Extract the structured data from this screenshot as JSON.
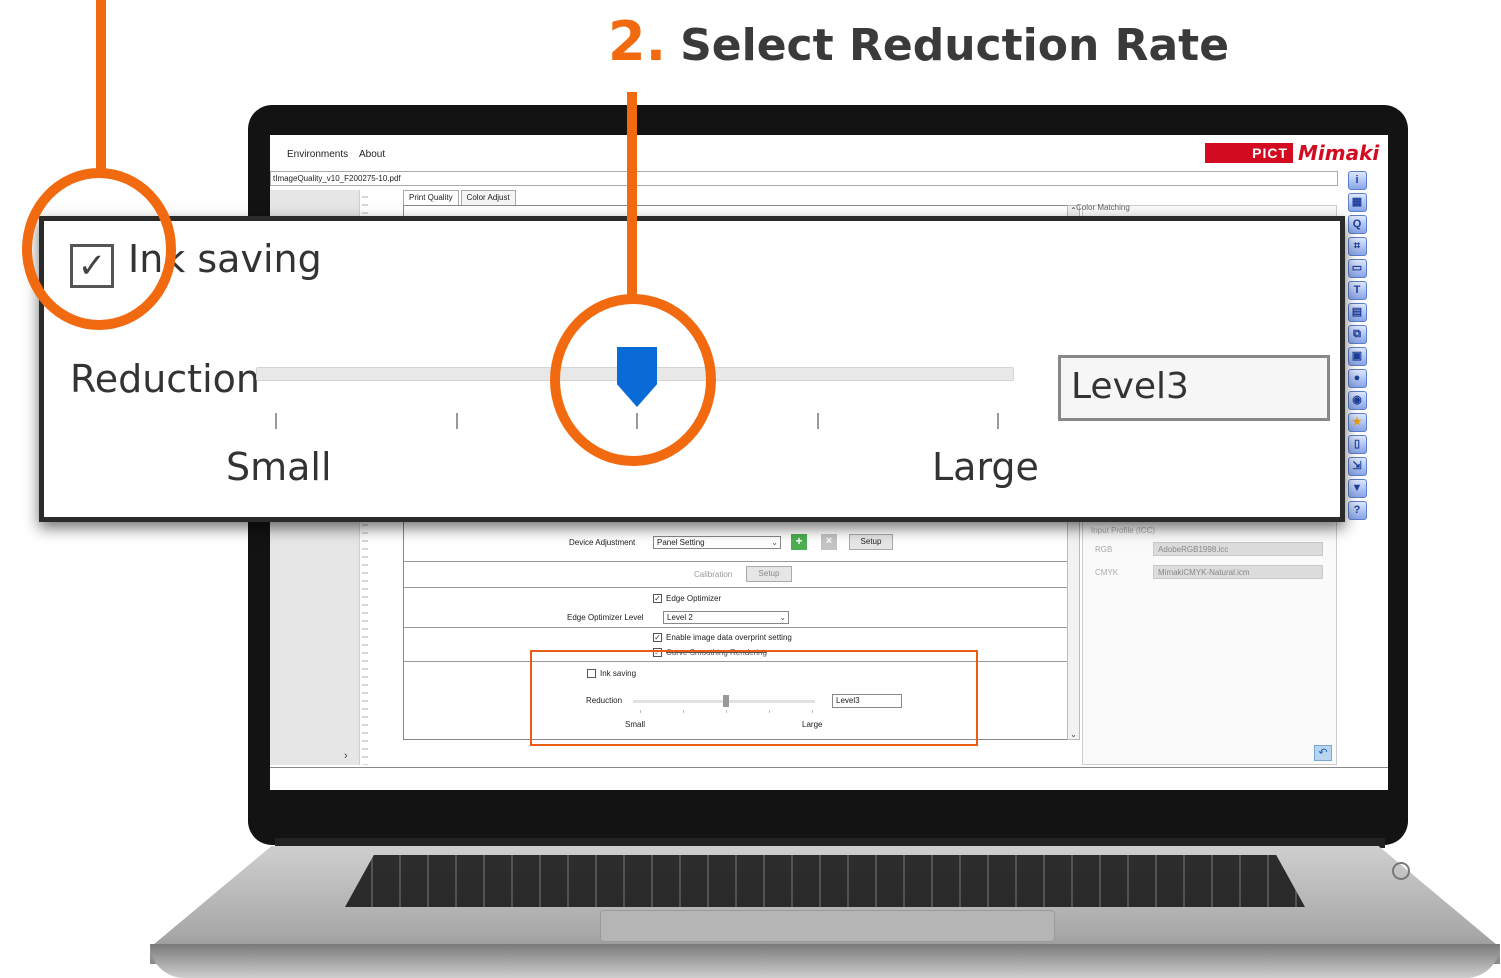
{
  "annotation": {
    "step_number": "2.",
    "step_title": "Select Reduction Rate",
    "accent_color": "#f26a10"
  },
  "app": {
    "menu": [
      "Environments",
      "About"
    ],
    "brand_pict": "PICT",
    "brand_mimaki": "Mimaki",
    "file_name": "tImageQuality_v10_F200275-10.pdf",
    "tabs": [
      "Print Quality",
      "Color Adjust"
    ],
    "left_pane_chevron": "›"
  },
  "settings": {
    "device_adjustment_label": "Device Adjustment",
    "device_adjustment_value": "Panel Setting",
    "setup_label": "Setup",
    "calibration_label": "Calibration",
    "edge_optimizer_label": "Edge Optimizer",
    "edge_optimizer_level_label": "Edge Optimizer Level",
    "edge_optimizer_level_value": "Level 2",
    "overprint_label": "Enable image data overprint setting",
    "curve_smoothing_label": "Curve Smoothing Rendering",
    "ink_saving_label": "Ink saving",
    "reduction_label": "Reduction",
    "reduction_value": "Level3",
    "small_label": "Small",
    "large_label": "Large"
  },
  "color_panel": {
    "color_matching_label": "Color Matching",
    "input_profile_label": "Input Profile (ICC)",
    "rgb_label": "RGB",
    "rgb_value": "AdobeRGB1998.icc",
    "cmyk_label": "CMYK",
    "cmyk_value": "MimakiCMYK-Natural.icm"
  },
  "zoom": {
    "ink_saving_label": "Ink saving",
    "reduction_label": "Reduction",
    "reduction_value": "Level3",
    "small_label": "Small",
    "large_label": "Large",
    "checkbox_mark": "✓"
  },
  "reduction_slider": {
    "level_count": 5,
    "selected_level": 3
  },
  "toolbar_icons": [
    "info-icon",
    "layout-icon",
    "search-icon",
    "crop-icon",
    "frame-icon",
    "text-icon",
    "layers-icon",
    "copy-icon",
    "image-icon",
    "color-icon",
    "palette-icon",
    "favorite-icon",
    "document-icon",
    "move-icon",
    "trash-icon",
    "help-icon"
  ]
}
